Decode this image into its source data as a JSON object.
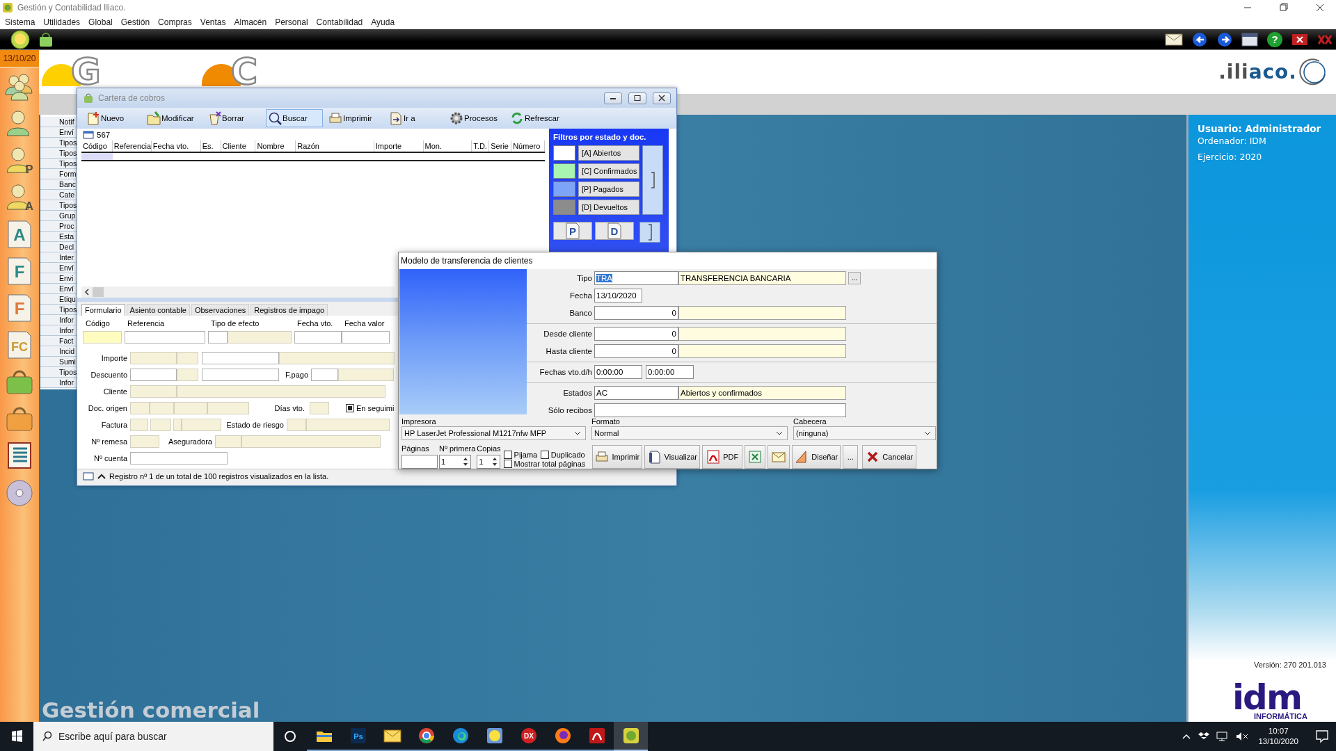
{
  "window": {
    "title": "Gestión y Contabilidad Iliaco."
  },
  "menu": [
    "Sistema",
    "Utilidades",
    "Global",
    "Gestión",
    "Compras",
    "Ventas",
    "Almacén",
    "Personal",
    "Contabilidad",
    "Ayuda"
  ],
  "toolbar": {
    "left": [
      {
        "kind": "orb"
      },
      {
        "kind": "bag"
      }
    ],
    "right": [
      {
        "kind": "mail"
      },
      {
        "kind": "back"
      },
      {
        "kind": "forward"
      },
      {
        "kind": "panel"
      },
      {
        "kind": "help",
        "glyph": "?"
      },
      {
        "kind": "close"
      },
      {
        "kind": "exit"
      }
    ]
  },
  "sidebar": {
    "date": "13/10/20",
    "items": [
      {
        "kind": "group"
      },
      {
        "kind": "person"
      },
      {
        "kind": "person",
        "letter": "P"
      },
      {
        "kind": "person",
        "letter": "A"
      },
      {
        "kind": "doc",
        "letter": "A",
        "color": "#2e8a86"
      },
      {
        "kind": "doc",
        "letter": "F",
        "color": "#2e8a86"
      },
      {
        "kind": "doc",
        "letter": "F",
        "color": "#e0783a"
      },
      {
        "kind": "doc",
        "letter": "FC",
        "color": "#c89a30"
      },
      {
        "kind": "bag",
        "color": "#7cc04a"
      },
      {
        "kind": "bag",
        "color": "#f0a040"
      },
      {
        "kind": "list"
      },
      {
        "kind": "disc"
      }
    ]
  },
  "banner": {
    "logos": [
      {
        "letter": "G",
        "color": "#ffd000"
      },
      {
        "letter": "C",
        "color": "#f08a00"
      }
    ],
    "brand": [
      ".ili",
      "aco."
    ]
  },
  "nav_list": [
    "Notif",
    "Enví",
    "Tipos",
    "Tipos",
    "Tipos",
    "Form",
    "Banc",
    "Cate",
    "Tipos",
    "Grup",
    "Proc",
    "Esta",
    "Decl",
    "Inter",
    "Enví",
    "Envi",
    "Enví",
    "Etiqu",
    "Tipos",
    "Infor",
    "Infor",
    "Fact",
    "Incid",
    "Sumi",
    "Tipos",
    "Infor"
  ],
  "module_title": "Gestión comercial",
  "info": {
    "user": "Usuario: Administrador",
    "computer": "Ordenador: IDM",
    "year": "Ejercicio: 2020",
    "version": "Versión: 270 201.013",
    "vendor": "idm",
    "vendor_sub": "INFORMÁTICA"
  },
  "cartera": {
    "title": "Cartera de cobros",
    "toolbar": [
      {
        "kind": "new",
        "label": "Nuevo",
        "selected": false
      },
      {
        "kind": "edit",
        "label": "Modificar",
        "selected": false
      },
      {
        "kind": "delete",
        "label": "Borrar",
        "selected": false
      },
      {
        "kind": "search",
        "label": "Buscar",
        "selected": true
      },
      {
        "kind": "print",
        "label": "Imprimir",
        "selected": false
      },
      {
        "kind": "goto",
        "label": "Ir a",
        "selected": false
      },
      {
        "kind": "process",
        "label": "Procesos",
        "selected": false
      },
      {
        "kind": "refresh",
        "label": "Refrescar",
        "selected": false
      }
    ],
    "record": "567",
    "columns": [
      "Código",
      "Referencia",
      "Fecha vto.",
      "Es.",
      "Cliente",
      "Nombre",
      "Razón",
      "Importe",
      "Mon.",
      "T.D.",
      "Serie",
      "Número"
    ],
    "filters": {
      "title": "Filtros por estado y doc.",
      "items": [
        {
          "label": "[A] Abiertos",
          "color": "#ffffff"
        },
        {
          "label": "[C] Confirmados",
          "color": "#a8f4b0"
        },
        {
          "label": "[P] Pagados",
          "color": "#7ea4f8"
        },
        {
          "label": "[D] Devueltos",
          "color": "#8c8c8c"
        }
      ],
      "doc_buttons": [
        "P",
        "D"
      ]
    },
    "tabs": [
      {
        "label": "Formulario",
        "selected": true
      },
      {
        "label": "Asiento contable",
        "selected": false
      },
      {
        "label": "Observaciones",
        "selected": false
      },
      {
        "label": "Registros de impago",
        "selected": false
      }
    ],
    "form": {
      "top_labels": [
        "Código",
        "Referencia",
        "Tipo de efecto",
        "Fecha vto.",
        "Fecha valor"
      ],
      "labels": [
        "Importe",
        "Descuento",
        "F.pago",
        "Cliente",
        "Doc. origen",
        "Días vto.",
        "Factura",
        "Estado de riesgo",
        "Nº remesa",
        "Aseguradora",
        "Nº cuenta"
      ],
      "follow_up": {
        "label": "En seguimi",
        "checked": true
      }
    },
    "status": "Registro nº 1 de un total de 100 registros visualizados en la lista."
  },
  "dialog": {
    "title": "Modelo de transferencia de clientes",
    "rows": [
      {
        "kind": "code",
        "label": "Tipo",
        "value": "TRA",
        "highlighted": true,
        "desc": "TRANSFERENCIA BANCARIA",
        "browse": "..."
      },
      {
        "kind": "date",
        "label": "Fecha",
        "value": "13/10/2020"
      },
      {
        "kind": "number",
        "label": "Banco",
        "value": "0"
      },
      {
        "kind": "number",
        "label": "Desde cliente",
        "value": "0",
        "group_start": true
      },
      {
        "kind": "number",
        "label": "Hasta cliente",
        "value": "0"
      },
      {
        "kind": "pair",
        "label": "Fechas vto.d/h",
        "values": [
          "0:00:00",
          "0:00:00"
        ],
        "group_start": true
      },
      {
        "kind": "code",
        "label": "Estados",
        "value": "AC",
        "highlighted": false,
        "desc": "Abiertos y confirmados",
        "group_start": true
      },
      {
        "kind": "text",
        "label": "Sólo recibos"
      }
    ],
    "selects": [
      {
        "label": "Impresora",
        "value": "HP LaserJet Professional M1217nfw MFP"
      },
      {
        "label": "Formato",
        "value": "Normal"
      },
      {
        "label": "Cabecera",
        "value": "(ninguna)"
      }
    ],
    "pages": {
      "label": "Páginas"
    },
    "spinners": [
      {
        "label": "Nº primera",
        "value": "1"
      },
      {
        "label": "Copias",
        "value": "1"
      }
    ],
    "checks": [
      {
        "label": "Pijama",
        "checked": false
      },
      {
        "label": "Duplicado",
        "checked": false
      },
      {
        "label": "Mostrar total páginas",
        "checked": false
      }
    ],
    "buttons": [
      {
        "kind": "print",
        "label": "Imprimir"
      },
      {
        "kind": "preview",
        "label": "Visualizar"
      },
      {
        "kind": "pdf",
        "label": "PDF"
      },
      {
        "kind": "excel"
      },
      {
        "kind": "mail"
      },
      {
        "kind": "design",
        "label": "Diseñar"
      },
      {
        "kind": "more",
        "label": "..."
      },
      {
        "kind": "cancel",
        "label": "Cancelar"
      }
    ]
  },
  "taskbar": {
    "search_placeholder": "Escribe aquí para buscar",
    "apps": [
      {
        "kind": "explorer",
        "selected": false
      },
      {
        "kind": "square",
        "letter": "Ps",
        "color": "#0a2a50",
        "selected": false
      },
      {
        "kind": "mail",
        "selected": false
      },
      {
        "kind": "chrome",
        "selected": false
      },
      {
        "kind": "edge",
        "selected": false
      },
      {
        "kind": "app",
        "selected": false
      },
      {
        "kind": "round",
        "letter": "DX",
        "color": "#d02020",
        "selected": false
      },
      {
        "kind": "firefox",
        "selected": false
      },
      {
        "kind": "acrobat",
        "selected": false
      },
      {
        "kind": "iliaco",
        "selected": true
      }
    ],
    "time": "10:07",
    "date": "13/10/2020"
  }
}
